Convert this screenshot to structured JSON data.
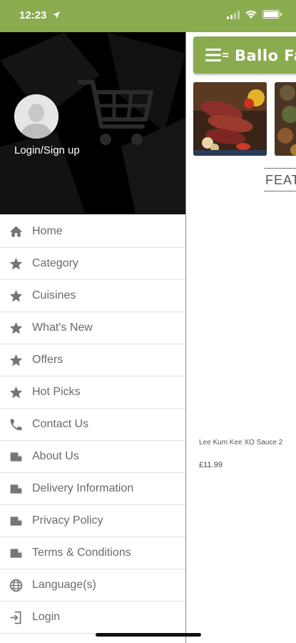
{
  "status": {
    "time": "12:23"
  },
  "app": {
    "title": "Ballo Fa"
  },
  "drawer": {
    "login_label": "Login/Sign up",
    "items": [
      {
        "label": "Home",
        "icon": "home-icon"
      },
      {
        "label": "Category",
        "icon": "star-icon"
      },
      {
        "label": "Cuisines",
        "icon": "star-icon"
      },
      {
        "label": "What's New",
        "icon": "star-icon"
      },
      {
        "label": "Offers",
        "icon": "star-icon"
      },
      {
        "label": "Hot Picks",
        "icon": "star-icon"
      },
      {
        "label": "Contact Us",
        "icon": "phone-icon"
      },
      {
        "label": "About Us",
        "icon": "page-icon"
      },
      {
        "label": "Delivery Information",
        "icon": "page-icon"
      },
      {
        "label": "Privacy Policy",
        "icon": "page-icon"
      },
      {
        "label": "Terms & Conditions",
        "icon": "page-icon"
      },
      {
        "label": "Language(s)",
        "icon": "globe-icon"
      },
      {
        "label": "Login",
        "icon": "login-icon"
      }
    ]
  },
  "main": {
    "featured_label": "FEAT",
    "product": {
      "name": "Lee Kum Kee XO Sauce 2",
      "price": "£11.99"
    }
  },
  "colors": {
    "accent": "#8bab4f",
    "drawer_header": "#000000",
    "menu_text": "#6a6a6a"
  }
}
